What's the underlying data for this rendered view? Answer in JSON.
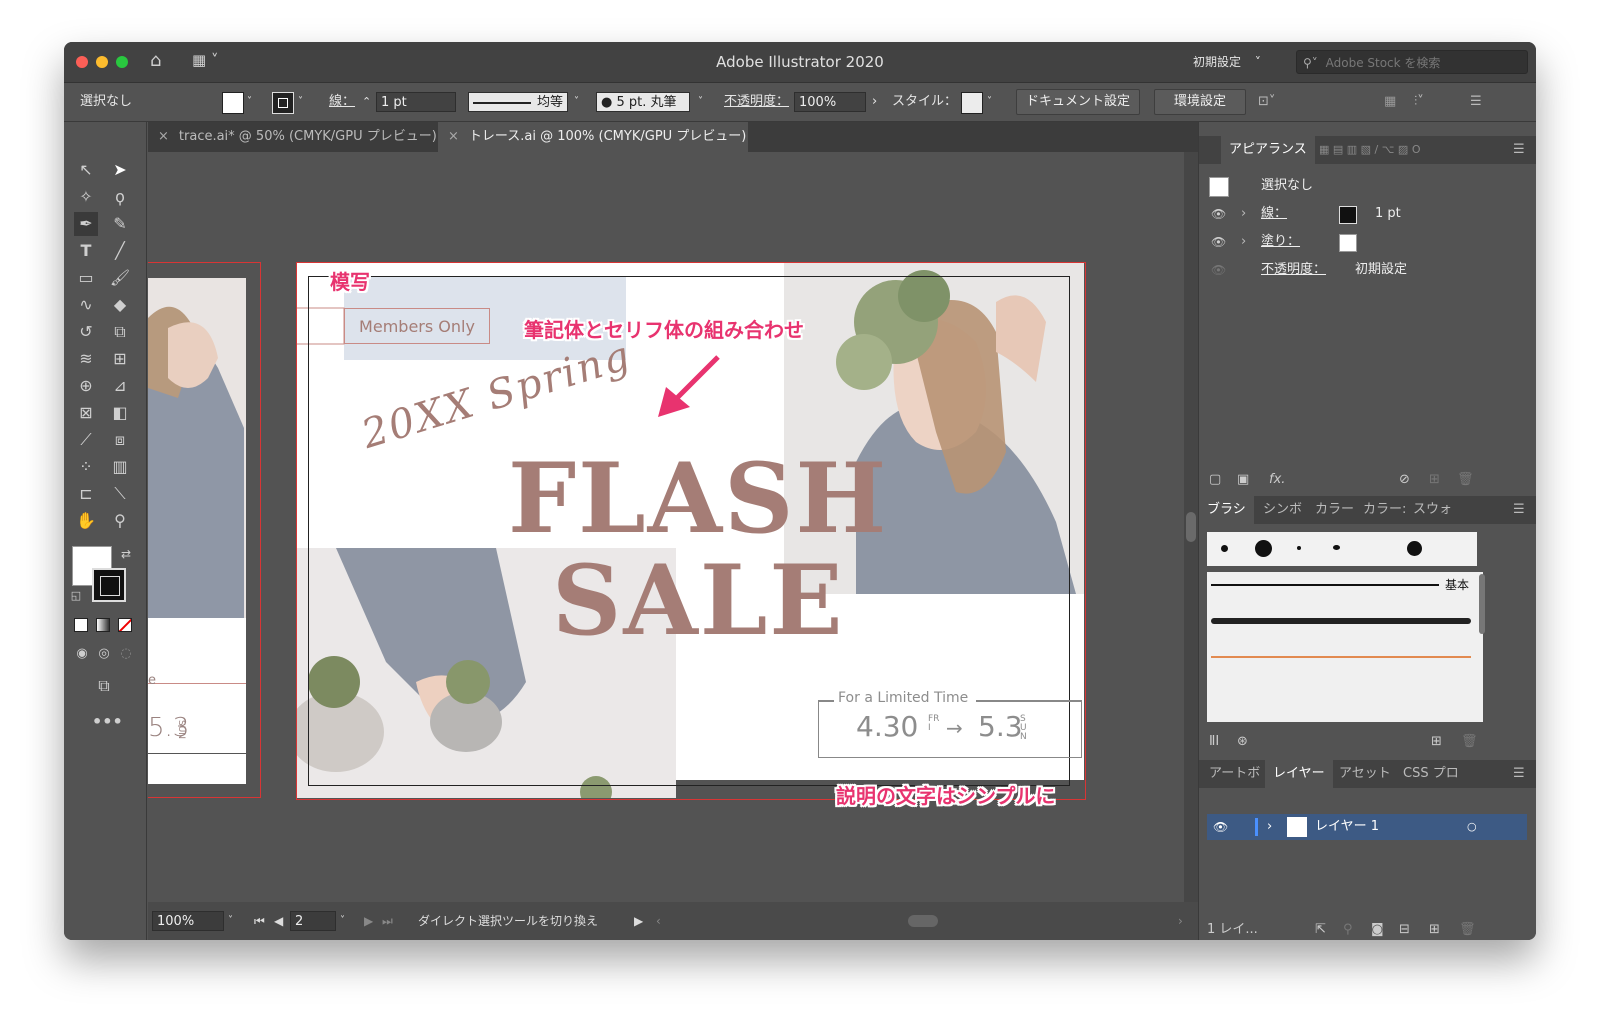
{
  "window": {
    "title": "Adobe Illustrator 2020",
    "workspace": "初期設定",
    "stock_search_placeholder": "Adobe Stock を検索"
  },
  "control_bar": {
    "selection": "選択なし",
    "stroke_label": "線：",
    "stroke_value": "1 pt",
    "profile_label": "均等",
    "brush_label": "5 pt. 丸筆",
    "opacity_label": "不透明度：",
    "opacity_value": "100%",
    "style_label": "スタイル：",
    "doc_settings_button": "ドキュメント設定",
    "preferences_button": "環境設定"
  },
  "tabs": [
    {
      "label": "trace.ai* @ 50% (CMYK/GPU プレビュー)"
    },
    {
      "label": "トレース.ai @ 100% (CMYK/GPU プレビュー)"
    }
  ],
  "artwork": {
    "badge": "Members Only",
    "script_text": "20XX Spring",
    "headline_1": "FLASH",
    "headline_2": "SALE",
    "limited_label": "For a Limited Time",
    "date_start": "4.30",
    "day_start": "FRI",
    "date_end": "5.3",
    "day_end": "SUN",
    "left_date": "5.3",
    "left_day": "SUN",
    "left_partial": "e",
    "colors": {
      "mauve": "#a57d76",
      "red_border": "#d83535",
      "annotation": "#e8336f"
    }
  },
  "annotations": {
    "trace": "模写",
    "font_combo": "筆記体とセリフ体の組み合わせ",
    "simple_text": "説明の文字はシンプルに"
  },
  "status_bar": {
    "zoom": "100%",
    "artboard_num": "2",
    "tool_hint": "ダイレクト選択ツールを切り換え"
  },
  "appearance_panel": {
    "tab": "アピアランス",
    "selection": "選択なし",
    "stroke_label": "線：",
    "stroke_value": "1 pt",
    "fill_label": "塗り：",
    "opacity_label": "不透明度：",
    "opacity_value": "初期設定"
  },
  "brush_panel": {
    "tabs": [
      "ブラシ",
      "シンボ",
      "カラー",
      "カラー:",
      "スウォ"
    ],
    "basic_label": "基本"
  },
  "layers_panel": {
    "tabs": [
      "アートボ",
      "レイヤー",
      "アセット",
      "CSS プロ"
    ],
    "layer_name": "レイヤー 1",
    "footer_count": "1 レイ..."
  }
}
